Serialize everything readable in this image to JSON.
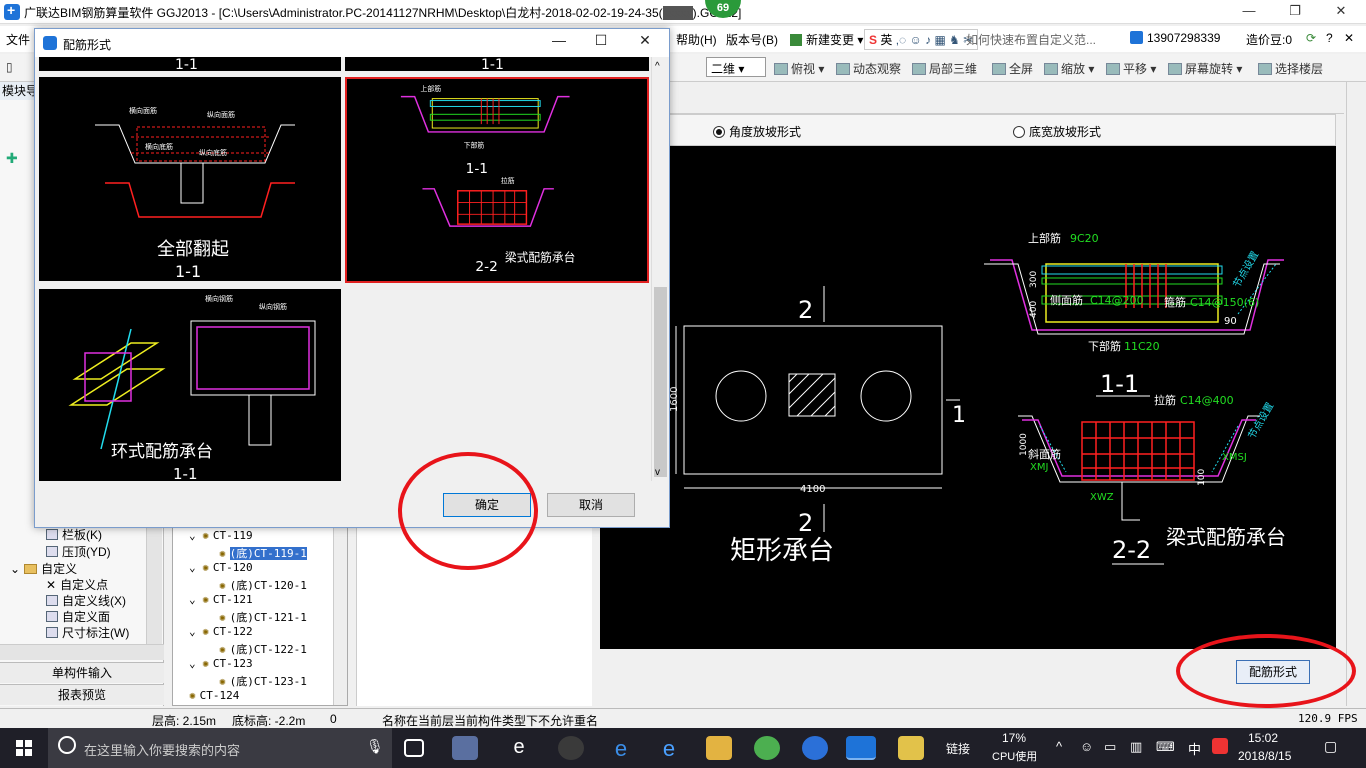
{
  "titlebar": {
    "title": "广联达BIM钢筋算量软件 GGJ2013 - [C:\\Users\\Administrator.PC-20141127NRHM\\Desktop\\白龙村-2018-02-02-19-24-35(",
    "title_tail": ").GGJ12]",
    "badge": "69"
  },
  "menubar": {
    "file": "文件",
    "help": "帮助(H)",
    "version": "版本号(B)",
    "new_change": "新建变更",
    "ime_lang": "英",
    "notice": "如何快速布置自定义范...",
    "phone": "13907298339",
    "coins": "造价豆:0"
  },
  "toolbar": {
    "view_2d": "二维",
    "top_view": "俯视",
    "dynamic_view": "动态观察",
    "local_3d": "局部三维",
    "full_screen": "全屏",
    "zoom": "缩放",
    "pan": "平移",
    "rotate": "屏幕旋转",
    "select_floor": "选择楼层"
  },
  "left_panel": {
    "header": "模块导",
    "items": [
      "栏板(K)",
      "压顶(YD)",
      "自定义",
      "自定义点",
      "自定义线(X)",
      "自定义面",
      "尺寸标注(W)"
    ],
    "single_input": "单构件输入",
    "report_preview": "报表预览"
  },
  "ct_tree": [
    {
      "label": "CT-119",
      "sub": "(底)CT-119-1",
      "selected": true
    },
    {
      "label": "CT-120",
      "sub": "(底)CT-120-1"
    },
    {
      "label": "CT-121",
      "sub": "(底)CT-121-1"
    },
    {
      "label": "CT-122",
      "sub": "(底)CT-122-1"
    },
    {
      "label": "CT-123",
      "sub": "(底)CT-123-1"
    },
    {
      "label": "CT-124"
    }
  ],
  "right_panel": {
    "radio_angle": "角度放坡形式",
    "radio_bottom": "底宽放坡形式",
    "peijin_button": "配筋形式",
    "cad": {
      "rect_title": "矩形承台",
      "sec_2_top": "2",
      "sec_2_bottom": "2",
      "sec_1": "1",
      "dim_width": "4100",
      "dim_height": "1600",
      "top_label": "上部筋",
      "top_value": "9C20",
      "side_label": "侧面筋",
      "side_value": "C14@200",
      "stirrup_label": "箍筋",
      "stirrup_value": "C14@150(6)",
      "bottom_label": "下部筋",
      "bottom_value": "11C20",
      "section_1_1": "1-1",
      "la_label": "拉筋",
      "la_value": "C14@400",
      "slope_label": "斜面筋",
      "xmj": "XMJ",
      "xmsj": "XMSJ",
      "xwz": "XWZ",
      "section_2_2": "2-2",
      "beam_title": "梁式配筋承台",
      "dim_300": "300",
      "dim_400": "400",
      "dim_1000": "1000",
      "dim_100": "100",
      "angle_90": "90",
      "jiedian": "节点设置"
    }
  },
  "statusbar": {
    "floor_height": "层高: 2.15m",
    "base_elev": "底标高: -2.2m",
    "zero": "0",
    "message": "名称在当前层当前构件类型下不允许重名",
    "fps": "120.9 FPS"
  },
  "dialog": {
    "title": "配筋形式",
    "ok": "确定",
    "cancel": "取消",
    "thumbs": {
      "top_a": "1-1",
      "top_b": "1-1",
      "full_flip": "全部翻起",
      "full_flip_sec": "1-1",
      "beam_sec1": "1-1",
      "beam_sec2": "2-2",
      "beam_title": "梁式配筋承台",
      "ring_title": "环式配筋承台",
      "ring_sec": "1-1",
      "horiz_face": "横向面筋",
      "long_face": "纵向面筋",
      "horiz_bottom": "横向底筋",
      "long_bottom": "纵向底筋",
      "horiz_bar": "横向钢筋",
      "long_bar": "纵向钢筋",
      "top_bar": "上部筋",
      "bottom_bar": "下部筋",
      "la_bar": "拉筋"
    }
  },
  "taskbar": {
    "search_placeholder": "在这里输入你要搜索的内容",
    "link": "链接",
    "cpu_pct": "17%",
    "cpu_label": "CPU使用",
    "lang": "中",
    "time": "15:02",
    "date": "2018/8/15"
  },
  "colors": {
    "cad_bg": "#000000",
    "cad_cyan": "#22ddee",
    "cad_magenta": "#e030e0",
    "cad_green": "#22dd22",
    "cad_red": "#ff2020",
    "cad_yellow": "#eeee20",
    "annotation_red": "#e8141a",
    "accent_blue": "#1e73d8"
  }
}
